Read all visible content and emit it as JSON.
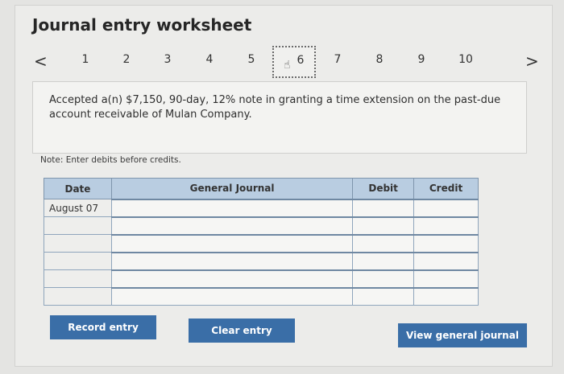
{
  "title": "Journal entry worksheet",
  "pager": {
    "prev_icon": "chevron-left-icon",
    "next_icon": "chevron-right-icon",
    "prev_glyph": "<",
    "next_glyph": ">",
    "pages": [
      "1",
      "2",
      "3",
      "4",
      "5",
      "6",
      "7",
      "8",
      "9",
      "10"
    ],
    "active_page": "6"
  },
  "description": "Accepted a(n) $7,150, 90-day, 12% note in granting a time extension on the past-due account receivable of Mulan Company.",
  "note": "Note: Enter debits before credits.",
  "table": {
    "headers": {
      "date": "Date",
      "journal": "General Journal",
      "debit": "Debit",
      "credit": "Credit"
    },
    "rows": [
      {
        "date": "August 07",
        "journal": "",
        "debit": "",
        "credit": ""
      },
      {
        "date": "",
        "journal": "",
        "debit": "",
        "credit": ""
      },
      {
        "date": "",
        "journal": "",
        "debit": "",
        "credit": ""
      },
      {
        "date": "",
        "journal": "",
        "debit": "",
        "credit": ""
      },
      {
        "date": "",
        "journal": "",
        "debit": "",
        "credit": ""
      },
      {
        "date": "",
        "journal": "",
        "debit": "",
        "credit": ""
      }
    ]
  },
  "buttons": {
    "record": "Record entry",
    "clear": "Clear entry",
    "view": "View general journal"
  },
  "colors": {
    "button": "#3a6ea7",
    "header": "#b9cde1"
  }
}
